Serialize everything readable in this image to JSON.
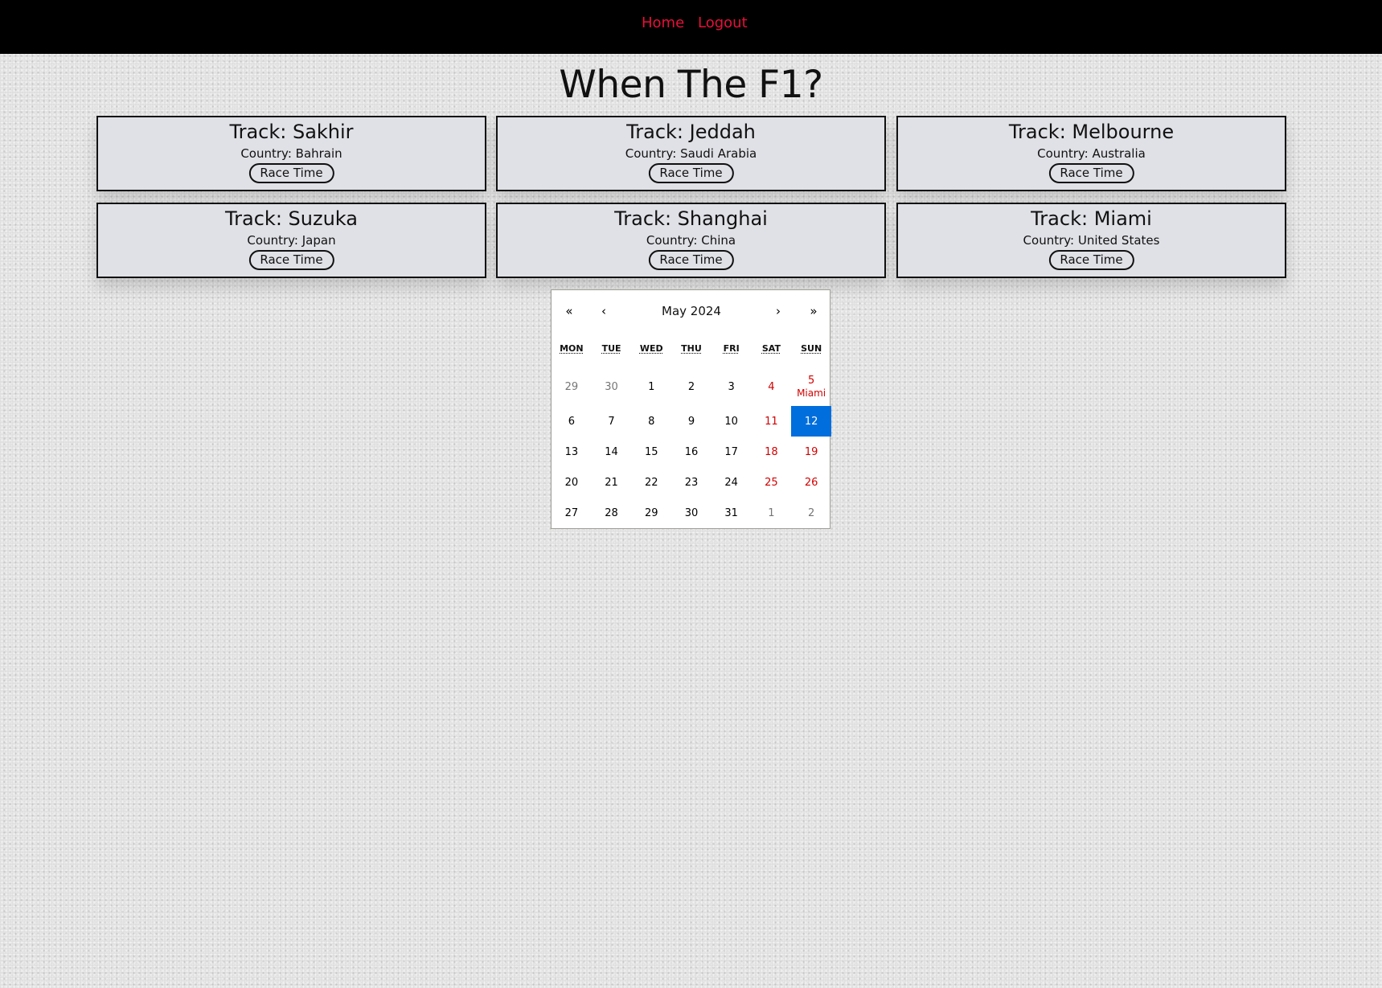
{
  "nav": {
    "home": "Home",
    "logout": "Logout"
  },
  "page": {
    "title": "When The F1?"
  },
  "tracks": [
    {
      "track": "Track: Sakhir",
      "country": "Country: Bahrain",
      "button": "Race Time"
    },
    {
      "track": "Track: Jeddah",
      "country": "Country: Saudi Arabia",
      "button": "Race Time"
    },
    {
      "track": "Track: Melbourne",
      "country": "Country: Australia",
      "button": "Race Time"
    },
    {
      "track": "Track: Suzuka",
      "country": "Country: Japan",
      "button": "Race Time"
    },
    {
      "track": "Track: Shanghai",
      "country": "Country: China",
      "button": "Race Time"
    },
    {
      "track": "Track: Miami",
      "country": "Country: United States",
      "button": "Race Time"
    }
  ],
  "calendar": {
    "label": "May 2024",
    "prev2": "«",
    "prev": "‹",
    "next": "›",
    "next2": "»",
    "weekdays": [
      "MON",
      "TUE",
      "WED",
      "THU",
      "FRI",
      "SAT",
      "SUN"
    ],
    "weeks": [
      [
        {
          "day": "29",
          "type": "neighbor"
        },
        {
          "day": "30",
          "type": "neighbor"
        },
        {
          "day": "1",
          "type": "normal"
        },
        {
          "day": "2",
          "type": "normal"
        },
        {
          "day": "3",
          "type": "normal"
        },
        {
          "day": "4",
          "type": "weekend"
        },
        {
          "day": "5",
          "type": "weekend",
          "event": "Miami"
        }
      ],
      [
        {
          "day": "6",
          "type": "normal"
        },
        {
          "day": "7",
          "type": "normal"
        },
        {
          "day": "8",
          "type": "normal"
        },
        {
          "day": "9",
          "type": "normal"
        },
        {
          "day": "10",
          "type": "normal"
        },
        {
          "day": "11",
          "type": "weekend"
        },
        {
          "day": "12",
          "type": "active"
        }
      ],
      [
        {
          "day": "13",
          "type": "normal"
        },
        {
          "day": "14",
          "type": "normal"
        },
        {
          "day": "15",
          "type": "normal"
        },
        {
          "day": "16",
          "type": "normal"
        },
        {
          "day": "17",
          "type": "normal"
        },
        {
          "day": "18",
          "type": "weekend"
        },
        {
          "day": "19",
          "type": "weekend"
        }
      ],
      [
        {
          "day": "20",
          "type": "normal"
        },
        {
          "day": "21",
          "type": "normal"
        },
        {
          "day": "22",
          "type": "normal"
        },
        {
          "day": "23",
          "type": "normal"
        },
        {
          "day": "24",
          "type": "normal"
        },
        {
          "day": "25",
          "type": "weekend"
        },
        {
          "day": "26",
          "type": "weekend"
        }
      ],
      [
        {
          "day": "27",
          "type": "normal"
        },
        {
          "day": "28",
          "type": "normal"
        },
        {
          "day": "29",
          "type": "normal"
        },
        {
          "day": "30",
          "type": "normal"
        },
        {
          "day": "31",
          "type": "normal"
        },
        {
          "day": "1",
          "type": "neighbor"
        },
        {
          "day": "2",
          "type": "neighbor"
        }
      ]
    ]
  },
  "colors": {
    "nav_link": "#e8103a",
    "weekend": "#d10000",
    "active_day": "#006edc",
    "card_bg": "#e0e1e6"
  }
}
